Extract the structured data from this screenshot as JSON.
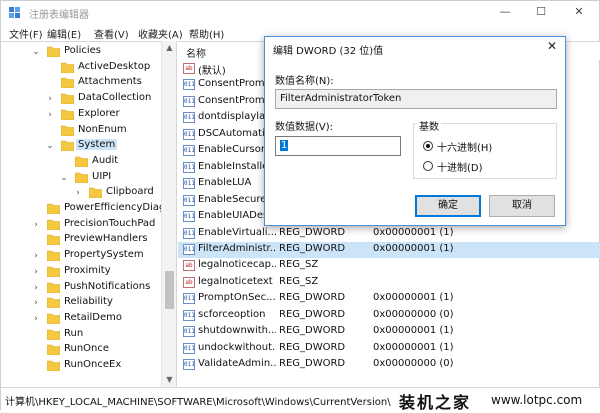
{
  "window": {
    "title": "注册表编辑器",
    "controls": {
      "minimize": "—",
      "maximize": "☐",
      "close": "✕"
    }
  },
  "menu": [
    "文件(F)",
    "编辑(E)",
    "查看(V)",
    "收藏夹(A)",
    "帮助(H)"
  ],
  "tree": {
    "items": [
      {
        "label": "Policies",
        "expander": "⌄"
      },
      {
        "label": "ActiveDesktop",
        "expander": ""
      },
      {
        "label": "Attachments",
        "expander": ""
      },
      {
        "label": "DataCollection",
        "expander": "›"
      },
      {
        "label": "Explorer",
        "expander": "›"
      },
      {
        "label": "NonEnum",
        "expander": ""
      },
      {
        "label": "System",
        "expander": "⌄"
      },
      {
        "label": "Audit",
        "expander": ""
      },
      {
        "label": "UIPI",
        "expander": "⌄"
      },
      {
        "label": "Clipboard",
        "expander": "›"
      },
      {
        "label": "PowerEfficiencyDiag",
        "expander": ""
      },
      {
        "label": "PrecisionTouchPad",
        "expander": "›"
      },
      {
        "label": "PreviewHandlers",
        "expander": ""
      },
      {
        "label": "PropertySystem",
        "expander": "›"
      },
      {
        "label": "Proximity",
        "expander": "›"
      },
      {
        "label": "PushNotifications",
        "expander": "›"
      },
      {
        "label": "Reliability",
        "expander": "›"
      },
      {
        "label": "RetailDemo",
        "expander": "›"
      },
      {
        "label": "Run",
        "expander": ""
      },
      {
        "label": "RunOnce",
        "expander": ""
      },
      {
        "label": "RunOnceEx",
        "expander": ""
      }
    ],
    "selected": "System"
  },
  "list": {
    "columns": {
      "name": "名称"
    },
    "rows": [
      {
        "icon": "ab",
        "name": "(默认)",
        "type": "",
        "data": ""
      },
      {
        "icon": "011",
        "name": "ConsentProm...",
        "type": "",
        "data": ""
      },
      {
        "icon": "011",
        "name": "ConsentProm...",
        "type": "",
        "data": ""
      },
      {
        "icon": "011",
        "name": "dontdisplaylas",
        "type": "",
        "data": ""
      },
      {
        "icon": "011",
        "name": "DSCAutomatio",
        "type": "",
        "data": ""
      },
      {
        "icon": "011",
        "name": "EnableCursorS",
        "type": "",
        "data": ""
      },
      {
        "icon": "011",
        "name": "EnableInstaller",
        "type": "",
        "data": ""
      },
      {
        "icon": "011",
        "name": "EnableLUA",
        "type": "",
        "data": ""
      },
      {
        "icon": "011",
        "name": "EnableSecure...",
        "type": "",
        "data": ""
      },
      {
        "icon": "011",
        "name": "EnableUIADes...",
        "type": "",
        "data": ""
      },
      {
        "icon": "011",
        "name": "EnableVirtuali...",
        "type": "REG_DWORD",
        "data": "0x00000001 (1)"
      },
      {
        "icon": "011",
        "name": "FilterAdministr...",
        "type": "REG_DWORD",
        "data": "0x00000001 (1)"
      },
      {
        "icon": "ab",
        "name": "legalnoticecap...",
        "type": "REG_SZ",
        "data": ""
      },
      {
        "icon": "ab",
        "name": "legalnoticetext",
        "type": "REG_SZ",
        "data": ""
      },
      {
        "icon": "011",
        "name": "PromptOnSec...",
        "type": "REG_DWORD",
        "data": "0x00000001 (1)"
      },
      {
        "icon": "011",
        "name": "scforceoption",
        "type": "REG_DWORD",
        "data": "0x00000000 (0)"
      },
      {
        "icon": "011",
        "name": "shutdownwith...",
        "type": "REG_DWORD",
        "data": "0x00000001 (1)"
      },
      {
        "icon": "011",
        "name": "undockwithout...",
        "type": "REG_DWORD",
        "data": "0x00000001 (1)"
      },
      {
        "icon": "011",
        "name": "ValidateAdmin...",
        "type": "REG_DWORD",
        "data": "0x00000000 (0)"
      }
    ],
    "selected_index": 11
  },
  "status": {
    "path": "计算机\\HKEY_LOCAL_MACHINE\\SOFTWARE\\Microsoft\\Windows\\CurrentVersion\\Polic"
  },
  "watermark": {
    "cn": "装机之家",
    "url": "www.lotpc.com"
  },
  "dialog": {
    "title": "编辑 DWORD (32 位)值",
    "close": "✕",
    "name_label": "数值名称(N):",
    "name_value": "FilterAdministratorToken",
    "data_label": "数值数据(V):",
    "data_value": "1",
    "base_label": "基数",
    "hex_label": "十六进制(H)",
    "dec_label": "十进制(D)",
    "base_selected": "hex",
    "ok_label": "确定",
    "cancel_label": "取消"
  }
}
